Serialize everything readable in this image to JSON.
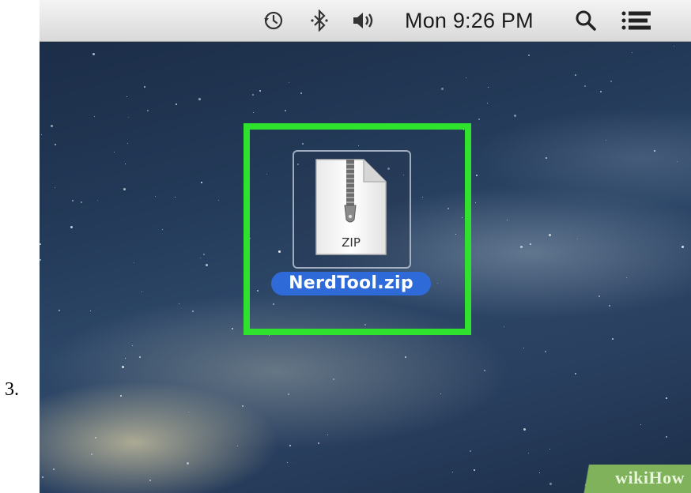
{
  "step": {
    "number": "3."
  },
  "menubar": {
    "icons": [
      "time-machine-icon",
      "bluetooth-icon",
      "volume-icon",
      "spotlight-search-icon",
      "notification-center-icon"
    ],
    "clock": "Mon 9:26 PM"
  },
  "desktop": {
    "file": {
      "icon_label": "ZIP",
      "name": "NerdTool.zip",
      "selected": true
    },
    "highlight_color": "#2ee22e"
  },
  "watermark": {
    "text": "wikiHow",
    "color": "#7fb25b"
  }
}
